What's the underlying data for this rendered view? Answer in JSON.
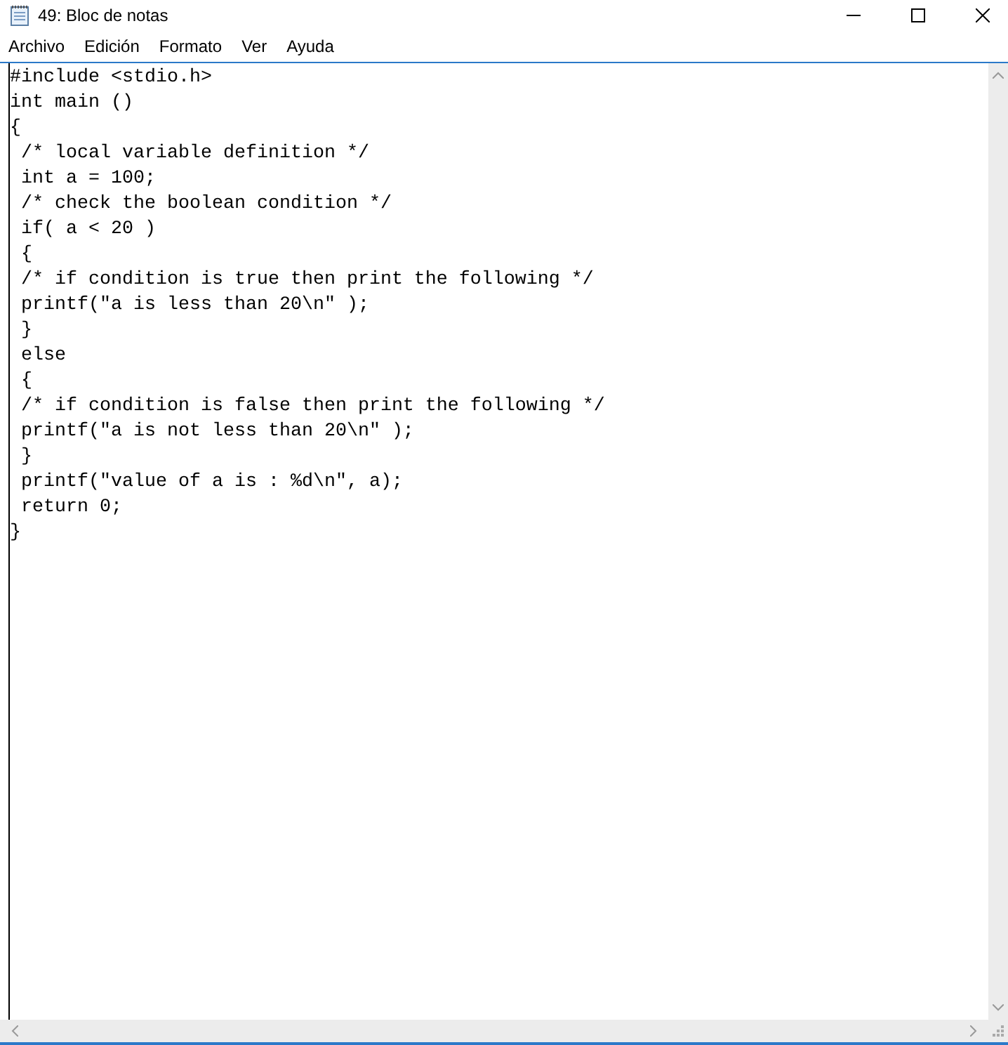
{
  "window": {
    "title": "49: Bloc de notas"
  },
  "menu": [
    "Archivo",
    "Edición",
    "Formato",
    "Ver",
    "Ayuda"
  ],
  "editor": {
    "lines": [
      "#include <stdio.h>",
      "int main ()",
      "{",
      " /* local variable definition */",
      " int a = 100;",
      " /* check the boolean condition */",
      " if( a < 20 )",
      " {",
      " /* if condition is true then print the following */",
      " printf(\"a is less than 20\\n\" );",
      " }",
      " else",
      " {",
      " /* if condition is false then print the following */",
      " printf(\"a is not less than 20\\n\" );",
      " }",
      " printf(\"value of a is : %d\\n\", a);",
      " return 0;",
      "}"
    ]
  }
}
